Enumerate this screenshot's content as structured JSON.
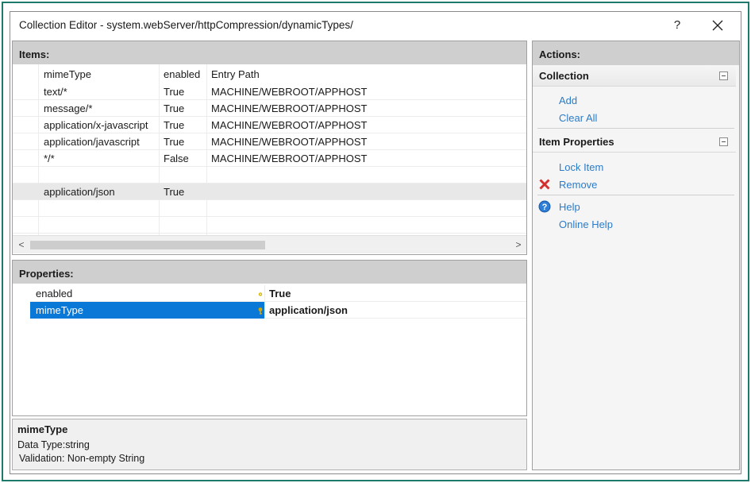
{
  "window": {
    "title": "Collection Editor - system.webServer/httpCompression/dynamicTypes/",
    "help_label": "?"
  },
  "items": {
    "header": "Items:",
    "columns": [
      "mimeType",
      "enabled",
      "Entry Path"
    ],
    "rows": [
      {
        "mimeType": "text/*",
        "enabled": "True",
        "entryPath": "MACHINE/WEBROOT/APPHOST"
      },
      {
        "mimeType": "message/*",
        "enabled": "True",
        "entryPath": "MACHINE/WEBROOT/APPHOST"
      },
      {
        "mimeType": "application/x-javascript",
        "enabled": "True",
        "entryPath": "MACHINE/WEBROOT/APPHOST"
      },
      {
        "mimeType": "application/javascript",
        "enabled": "True",
        "entryPath": "MACHINE/WEBROOT/APPHOST"
      },
      {
        "mimeType": "*/*",
        "enabled": "False",
        "entryPath": "MACHINE/WEBROOT/APPHOST"
      },
      {
        "mimeType": "",
        "enabled": "",
        "entryPath": ""
      },
      {
        "mimeType": "application/json",
        "enabled": "True",
        "entryPath": ""
      }
    ],
    "scroll_left": "<",
    "scroll_right": ">"
  },
  "properties": {
    "header": "Properties:",
    "rows": [
      {
        "name": "enabled",
        "value": "True"
      },
      {
        "name": "mimeType",
        "value": "application/json"
      }
    ]
  },
  "description": {
    "title": "mimeType",
    "line1": "Data Type:string",
    "line2": "Validation: Non-empty String"
  },
  "actions": {
    "header": "Actions:",
    "collection": {
      "title": "Collection",
      "add": "Add",
      "clear_all": "Clear All"
    },
    "item_properties": {
      "title": "Item Properties",
      "lock_item": "Lock Item",
      "remove": "Remove",
      "help": "Help",
      "online_help": "Online Help"
    }
  },
  "colors": {
    "link": "#2b7cc8",
    "selection": "#0a78d7",
    "header_bg": "#cfcfcf",
    "frame": "#1e7b6b",
    "remove_icon": "#d32f2f"
  }
}
